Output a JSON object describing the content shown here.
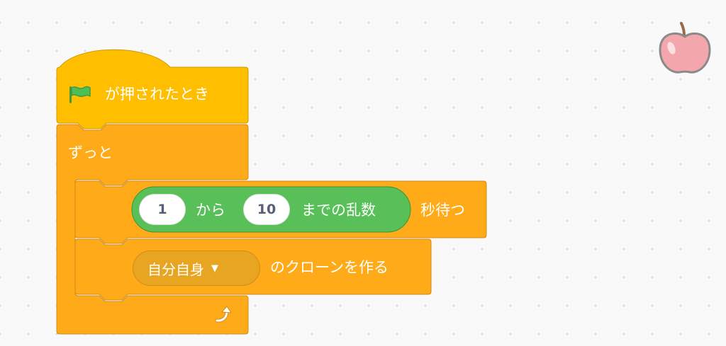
{
  "hat_block": {
    "label": "が押されたとき",
    "icon": "green-flag-icon"
  },
  "forever_block": {
    "label": "ずっと",
    "icon": "loop-arrow-icon"
  },
  "wait_block": {
    "suffix": "秒待つ",
    "random": {
      "from": "1",
      "middle": "から",
      "to": "10",
      "suffix": "までの乱数"
    }
  },
  "clone_block": {
    "menu_value": "自分自身",
    "suffix": "のクローンを作る"
  },
  "sprite": {
    "icon": "apple-icon"
  },
  "colors": {
    "control": "#ffab19",
    "control_border": "#cf8b17",
    "events": "#ffbf00",
    "operators": "#59c059",
    "operators_border": "#389438",
    "canvas": "#f9f9f9"
  }
}
